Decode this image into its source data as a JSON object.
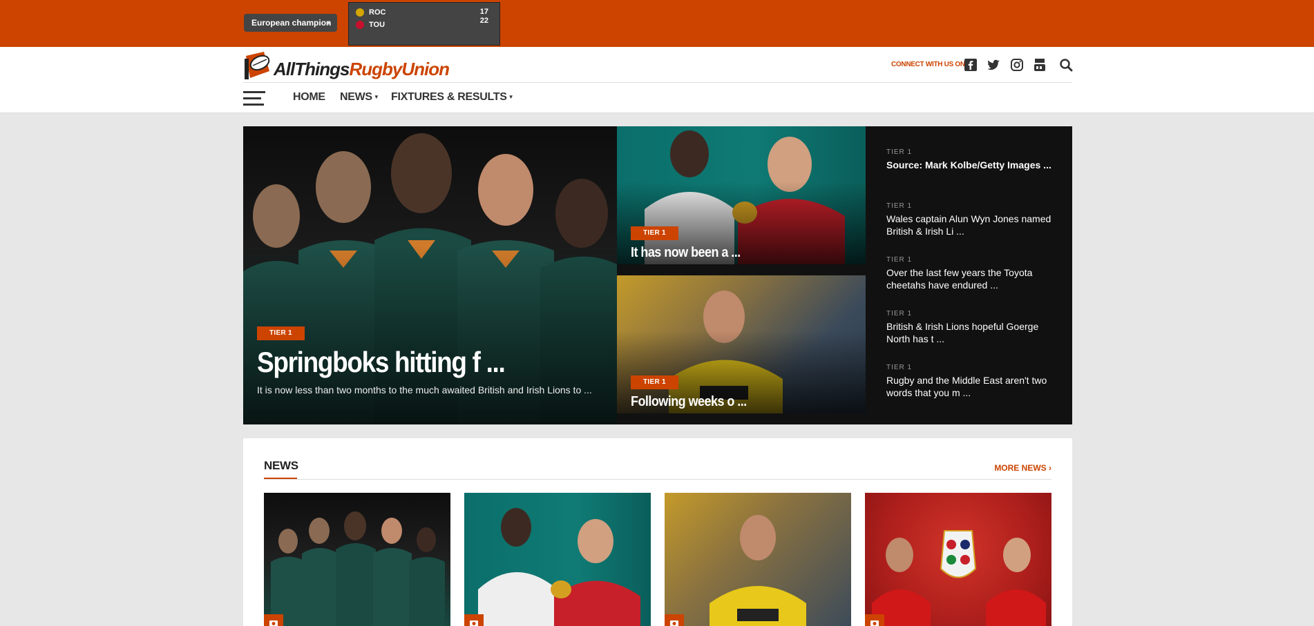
{
  "topbar": {
    "competition_label": "European champion",
    "match": {
      "home": {
        "abbr": "ROC",
        "score": "17",
        "crest_color": "#d4a600"
      },
      "away": {
        "abbr": "TOU",
        "score": "22",
        "crest_color": "#c8102e"
      }
    }
  },
  "header": {
    "logo": {
      "part1": "AllThings",
      "part2": "RugbyUnion"
    },
    "connect_label": "CONNECT WITH US ON",
    "social_icons": [
      "facebook-icon",
      "twitter-icon",
      "instagram-icon",
      "youtube-icon",
      "search-icon"
    ],
    "nav": [
      {
        "label": "HOME",
        "dropdown": false
      },
      {
        "label": "NEWS",
        "dropdown": true
      },
      {
        "label": "FIXTURES & RESULTS",
        "dropdown": true
      }
    ]
  },
  "featured": {
    "main": {
      "tag": "TIER 1",
      "title": "Springboks hitting f ...",
      "excerpt": "It is now less than two months to the much awaited British and Irish Lions to ..."
    },
    "small": [
      {
        "tag": "TIER 1",
        "title": "It has now been a ..."
      },
      {
        "tag": "TIER 1",
        "title": "Following weeks o ..."
      }
    ],
    "side": [
      {
        "category": "TIER 1",
        "title": "Source: Mark Kolbe/Getty Images ..."
      },
      {
        "category": "TIER 1",
        "title": "Wales captain Alun Wyn Jones named British & Irish Li ..."
      },
      {
        "category": "TIER 1",
        "title": "Over the last few years the Toyota cheetahs have endured ..."
      },
      {
        "category": "TIER 1",
        "title": "British & Irish Lions hopeful Goerge North has t ..."
      },
      {
        "category": "TIER 1",
        "title": "Rugby and the Middle East aren't two words that you m ..."
      }
    ]
  },
  "news": {
    "heading": "NEWS",
    "more_label": "MORE NEWS"
  },
  "colors": {
    "brand": "#cc4400",
    "dark": "#111111"
  }
}
